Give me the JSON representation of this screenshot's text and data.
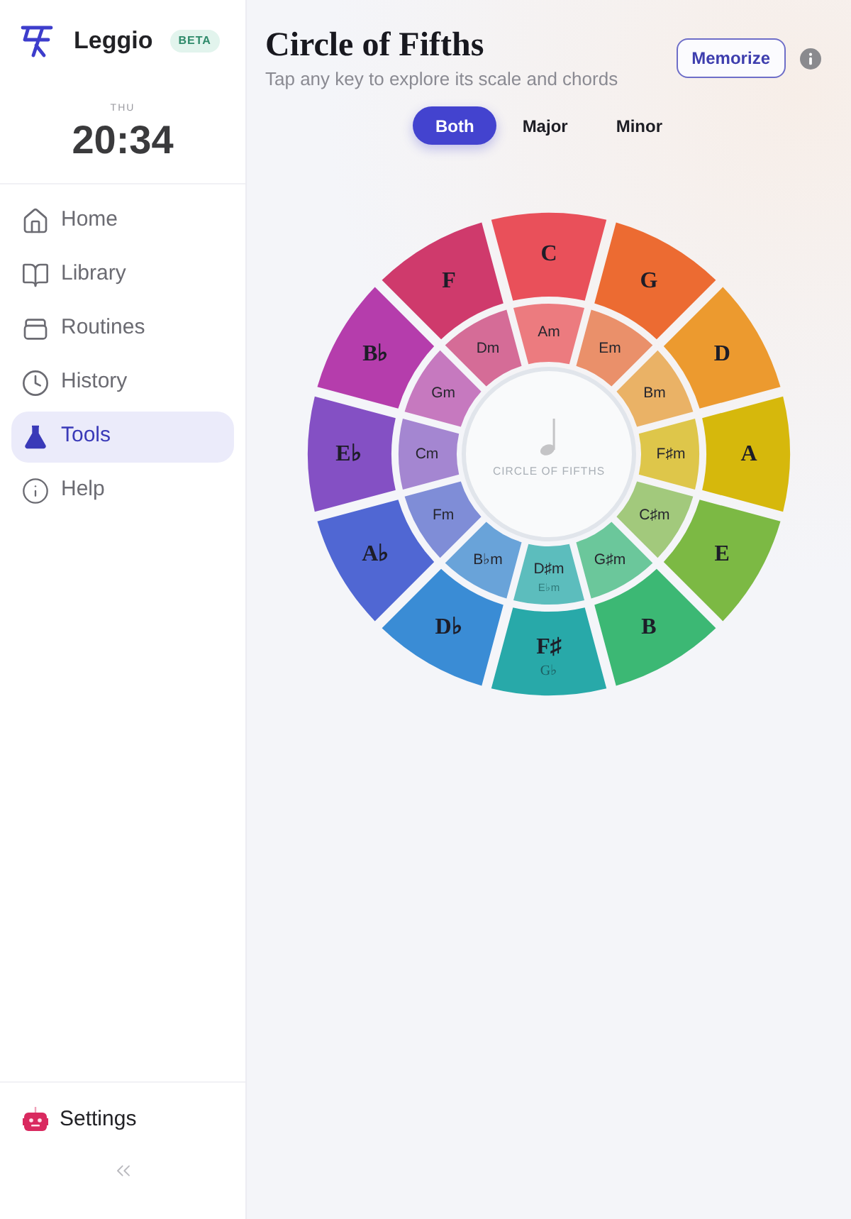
{
  "sidebar": {
    "brand": {
      "name": "Leggio",
      "badge": "BETA"
    },
    "clock": {
      "day": "THU",
      "time": "20:34"
    },
    "nav": [
      {
        "label": "Home",
        "selected": false
      },
      {
        "label": "Library",
        "selected": false
      },
      {
        "label": "Routines",
        "selected": false
      },
      {
        "label": "History",
        "selected": false
      },
      {
        "label": "Tools",
        "selected": true
      },
      {
        "label": "Help",
        "selected": false
      }
    ],
    "footer": {
      "settings": "Settings"
    }
  },
  "header": {
    "title": "Circle of Fifths",
    "subtitle": "Tap any key to explore its scale and chords",
    "action_button": "Memorize"
  },
  "mode_tabs": [
    {
      "label": "Both",
      "selected": true
    },
    {
      "label": "Major",
      "selected": false
    },
    {
      "label": "Minor",
      "selected": false
    }
  ],
  "circle": {
    "center_label": "CIRCLE OF FIFTHS",
    "major_keys": [
      {
        "label": "C",
        "color": "#e9505a"
      },
      {
        "label": "G",
        "color": "#ec6b32"
      },
      {
        "label": "D",
        "color": "#ec9a2f"
      },
      {
        "label": "A",
        "color": "#d6b80c"
      },
      {
        "label": "E",
        "color": "#7cb944"
      },
      {
        "label": "B",
        "color": "#3cb874"
      },
      {
        "label": "F♯",
        "alt_label": "G♭",
        "color": "#28a9a9"
      },
      {
        "label": "D♭",
        "color": "#3a8cd5"
      },
      {
        "label": "A♭",
        "color": "#5067d3"
      },
      {
        "label": "E♭",
        "color": "#8450c4"
      },
      {
        "label": "B♭",
        "color": "#b53dac"
      },
      {
        "label": "F",
        "color": "#cf3a6c"
      }
    ],
    "minor_keys": [
      {
        "label": "Am",
        "color": "#ec7b7f"
      },
      {
        "label": "Em",
        "color": "#ea906a"
      },
      {
        "label": "Bm",
        "color": "#eab266"
      },
      {
        "label": "F♯m",
        "color": "#dec64a"
      },
      {
        "label": "C♯m",
        "color": "#a2c97c"
      },
      {
        "label": "G♯m",
        "color": "#6bc79b"
      },
      {
        "label": "D♯m",
        "alt_label": "E♭m",
        "color": "#5cbdbd"
      },
      {
        "label": "B♭m",
        "color": "#69a3d9"
      },
      {
        "label": "Fm",
        "color": "#7f8dd7"
      },
      {
        "label": "Cm",
        "color": "#a486d1"
      },
      {
        "label": "Gm",
        "color": "#c679bf"
      },
      {
        "label": "Dm",
        "color": "#d56c97"
      }
    ]
  }
}
